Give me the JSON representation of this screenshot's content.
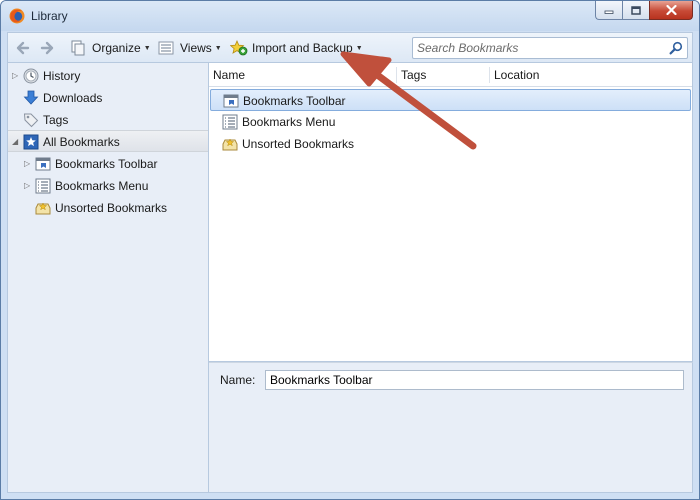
{
  "window": {
    "title": "Library"
  },
  "toolbar": {
    "back_icon": "back-arrow-icon",
    "forward_icon": "forward-arrow-icon",
    "organize_label": "Organize",
    "views_label": "Views",
    "import_backup_label": "Import and Backup",
    "search_placeholder": "Search Bookmarks"
  },
  "sidebar": {
    "items": [
      {
        "label": "History",
        "icon": "history-clock-icon",
        "twisty": true
      },
      {
        "label": "Downloads",
        "icon": "download-arrow-icon",
        "twisty": false
      },
      {
        "label": "Tags",
        "icon": "tag-icon",
        "twisty": false
      },
      {
        "label": "All Bookmarks",
        "icon": "all-bookmarks-star-icon",
        "twisty": true,
        "expanded": true,
        "selected": true
      },
      {
        "label": "Bookmarks Toolbar",
        "icon": "bookmarks-toolbar-icon",
        "twisty": true
      },
      {
        "label": "Bookmarks Menu",
        "icon": "bookmarks-menu-icon",
        "twisty": true
      },
      {
        "label": "Unsorted Bookmarks",
        "icon": "unsorted-bookmarks-icon",
        "twisty": false
      }
    ]
  },
  "list": {
    "columns": [
      "Name",
      "Tags",
      "Location"
    ],
    "rows": [
      {
        "name": "Bookmarks Toolbar",
        "icon": "bookmarks-toolbar-icon",
        "selected": true
      },
      {
        "name": "Bookmarks Menu",
        "icon": "bookmarks-menu-icon",
        "selected": false
      },
      {
        "name": "Unsorted Bookmarks",
        "icon": "unsorted-bookmarks-icon",
        "selected": false
      }
    ]
  },
  "details": {
    "name_label": "Name:",
    "name_value": "Bookmarks Toolbar"
  },
  "colors": {
    "window_frame": "#cfdff3",
    "selection": "#cde0f7",
    "annotation_arrow": "#c0503c"
  }
}
